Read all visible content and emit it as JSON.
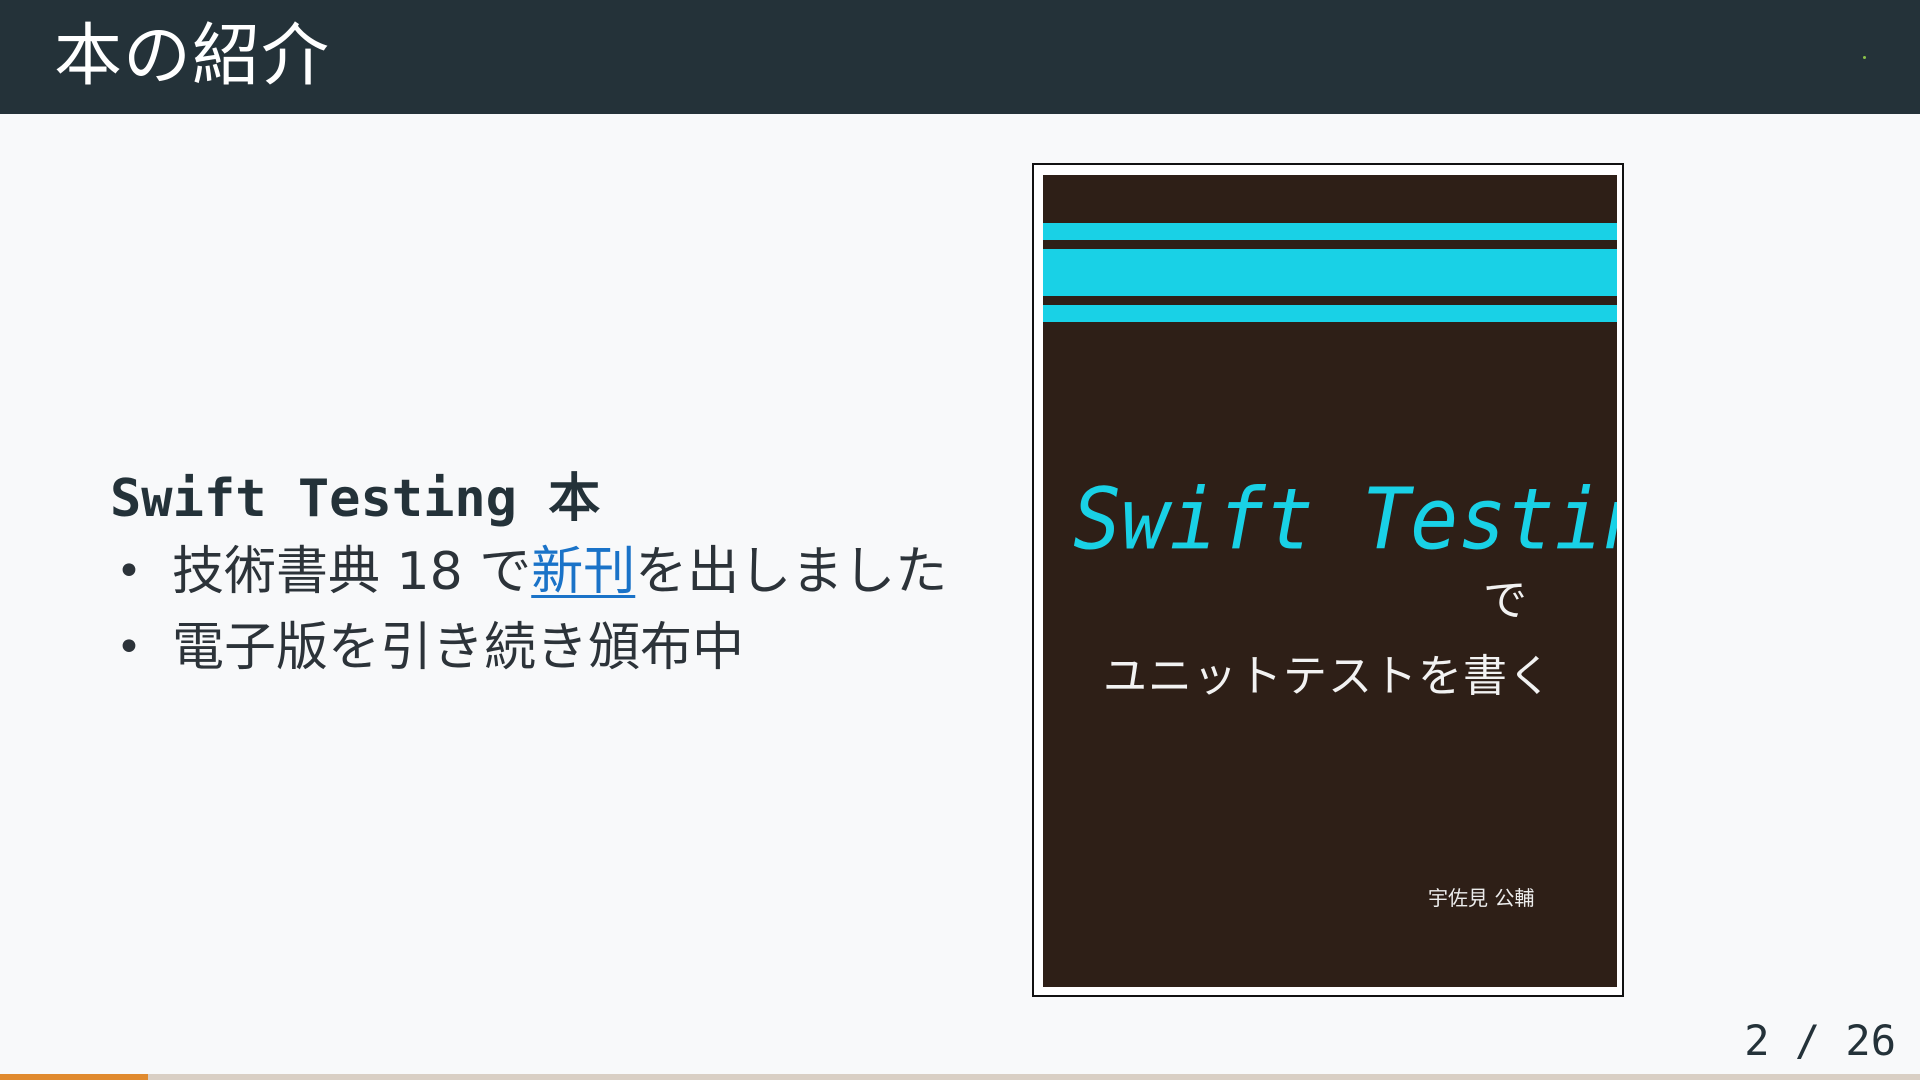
{
  "slide": {
    "title": "本の紹介"
  },
  "content": {
    "heading": "Swift Testing 本",
    "bullets": [
      {
        "before": "技術書典 18 で",
        "link": "新刊",
        "after": "を出しました"
      },
      {
        "before": "電子版を引き続き頒布中",
        "link": "",
        "after": ""
      }
    ]
  },
  "cover": {
    "title": "Swift Testing",
    "de": "で",
    "subtitle": "ユニットテストを書く",
    "author": "宇佐見 公輔"
  },
  "pager": {
    "current": 2,
    "total": 26,
    "text": "2 / 26"
  },
  "progress": {
    "fraction": 0.0769
  },
  "colors": {
    "header_bg": "#243239",
    "page_bg": "#f8f9fa",
    "link": "#1a73c8",
    "cover_bg": "#2e1f17",
    "cover_accent": "#19d1e6",
    "progress_fill": "#e08a2e",
    "progress_track": "#d9cfc4",
    "header_dot": "#8bc34a"
  }
}
